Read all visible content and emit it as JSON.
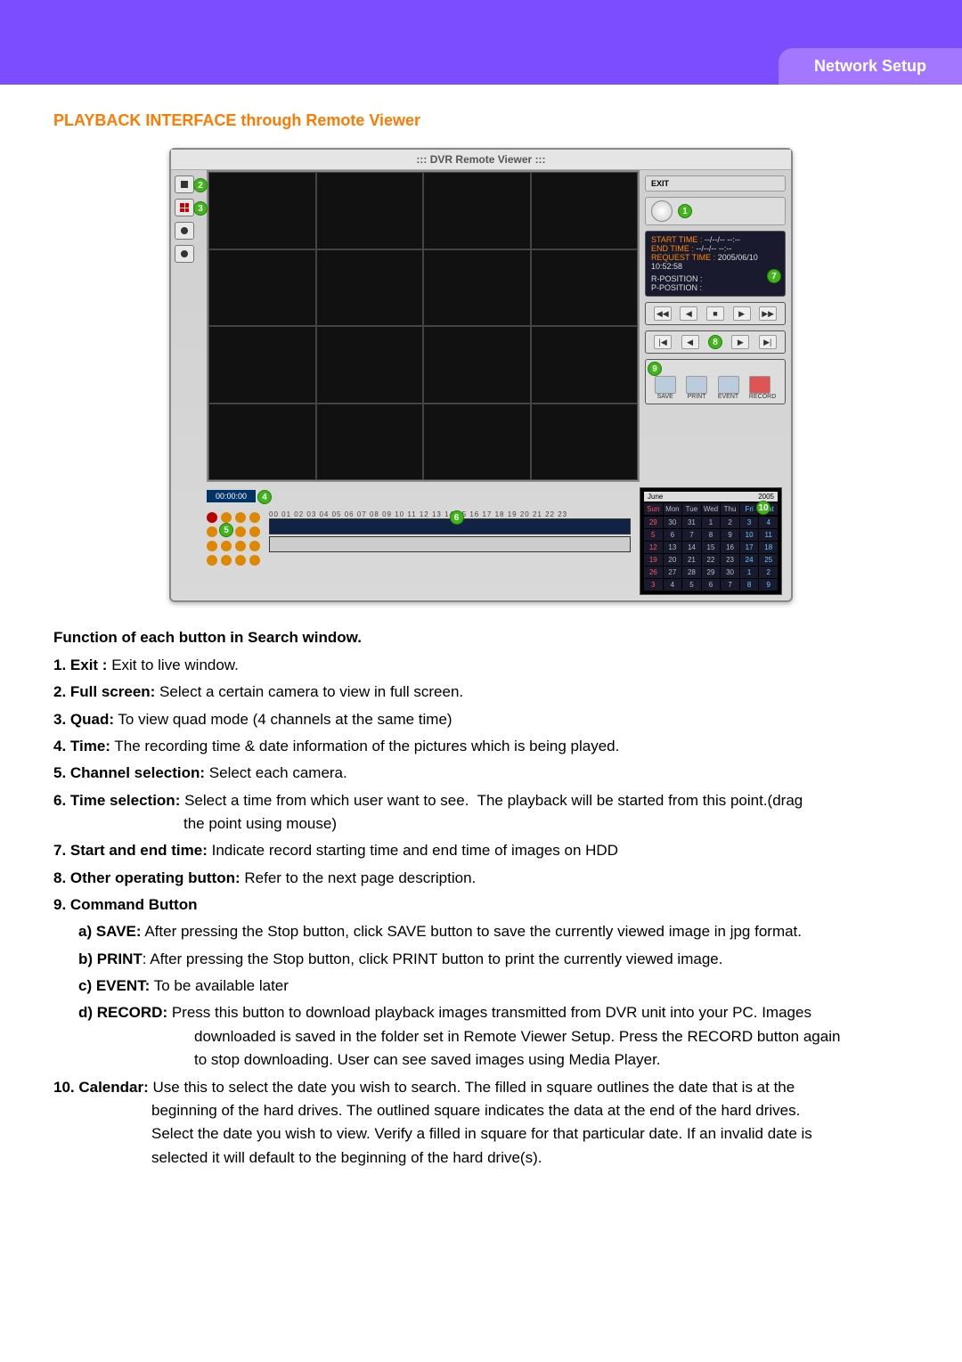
{
  "header": {
    "section_tab": "Network Setup"
  },
  "section_title": "PLAYBACK INTERFACE through Remote Viewer",
  "screenshot": {
    "title": "::: DVR Remote Viewer :::",
    "exit_label": "EXIT",
    "panel_time": {
      "start_label": "START TIME :",
      "start_value": "--/--/-- --:--",
      "end_label": "END TIME :",
      "end_value": "--/--/-- --:--",
      "request_label": "REQUEST TIME :",
      "request_value": "2005/06/10 10:52:58",
      "rpos": "R-POSITION :",
      "ppos": "P-POSITION :"
    },
    "cmd_labels": {
      "save": "SAVE",
      "print": "PRINT",
      "event": "EVENT",
      "record": "RECORD"
    },
    "time_display": "00:00:00",
    "hours": "00 01 02 03 04 05 06 07 08 09 10 11 12 13 14 15 16 17 18 19 20 21 22 23",
    "calendar": {
      "month": "June",
      "year": "2005",
      "days_header": [
        "Sun",
        "Mon",
        "Tue",
        "Wed",
        "Thu",
        "Fri",
        "Sat"
      ],
      "weeks": [
        [
          "29",
          "30",
          "31",
          "1",
          "2",
          "3",
          "4"
        ],
        [
          "5",
          "6",
          "7",
          "8",
          "9",
          "10",
          "11"
        ],
        [
          "12",
          "13",
          "14",
          "15",
          "16",
          "17",
          "18"
        ],
        [
          "19",
          "20",
          "21",
          "22",
          "23",
          "24",
          "25"
        ],
        [
          "26",
          "27",
          "28",
          "29",
          "30",
          "1",
          "2"
        ],
        [
          "3",
          "4",
          "5",
          "6",
          "7",
          "8",
          "9"
        ]
      ]
    },
    "markers": [
      "1",
      "2",
      "3",
      "4",
      "5",
      "6",
      "7",
      "8",
      "9",
      "10"
    ]
  },
  "functions": {
    "heading": "Function of each button in Search  window.",
    "items": [
      {
        "label": "1. Exit :",
        "text": " Exit to live window."
      },
      {
        "label": "2. Full screen:",
        "text": " Select a certain camera to view in full screen."
      },
      {
        "label": "3. Quad:",
        "text": " To view quad mode (4 channels at the same time)"
      },
      {
        "label": "4. Time:",
        "text": " The recording time & date information of the pictures which is being played."
      },
      {
        "label": "5. Channel selection:",
        "text": " Select each camera."
      },
      {
        "label": "6. Time selection:",
        "text": " Select a time from which user want to see.  The playback will be started from this point.(drag the point using mouse)"
      },
      {
        "label": "7. Start and end time:",
        "text": " Indicate record starting time and end time of images on HDD"
      },
      {
        "label": "8. Other operating button:",
        "text": " Refer to the next page description."
      },
      {
        "label": "9. Command Button",
        "text": ""
      }
    ],
    "subitems": [
      {
        "label": "a) SAVE:",
        "text": " After pressing the Stop button, click SAVE button to save the currently viewed image in jpg format."
      },
      {
        "label": "b) PRINT",
        "text": ": After pressing the Stop button, click PRINT button to print the currently viewed image."
      },
      {
        "label": "c) EVENT:",
        "text": " To be available later"
      },
      {
        "label": "d) RECORD:",
        "text": " Press this button to download playback images transmitted from DVR unit into your PC. Images downloaded is saved in the folder set in Remote Viewer Setup. Press the RECORD button again to stop downloading. User can see saved images using Media Player."
      }
    ],
    "item10": {
      "label": "10. Calendar:",
      "text": " Use this to select the date you wish to search. The filled in square outlines the date that is at the beginning of the hard drives. The outlined square indicates the data at the end of the hard drives. Select the date you wish to view. Verify a filled in square for that particular date. If an invalid date is selected it will default to the beginning of the hard drive(s)."
    }
  }
}
